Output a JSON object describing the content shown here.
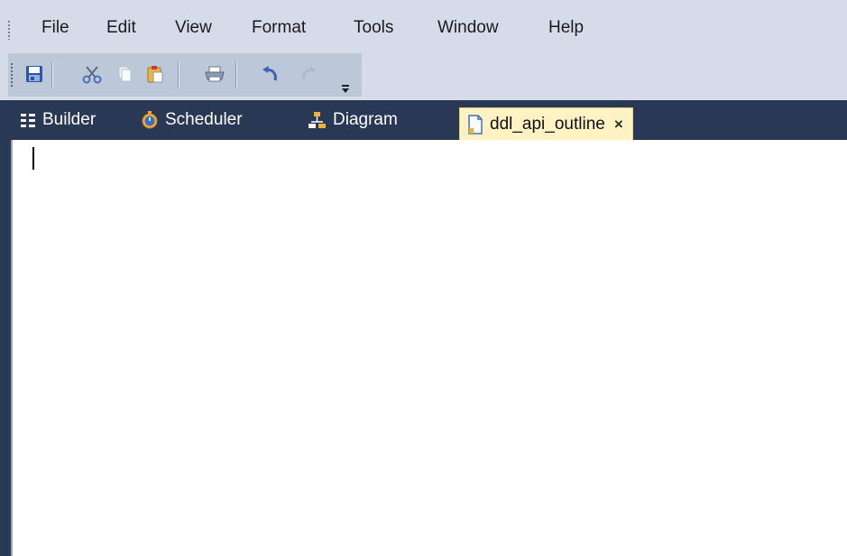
{
  "menu": {
    "items": [
      "File",
      "Edit",
      "View",
      "Format",
      "Tools",
      "Window",
      "Help"
    ]
  },
  "toolbar": {
    "buttons": [
      "save-icon",
      "cut-icon",
      "copy-icon",
      "paste-icon",
      "print-icon",
      "undo-icon",
      "redo-icon"
    ]
  },
  "tabs": {
    "builder": "Builder",
    "scheduler": "Scheduler",
    "diagram": "Diagram",
    "active": "ddl_api_outline",
    "close": "×"
  },
  "editor": {
    "content": ""
  },
  "colors": {
    "menubar": "#d6dbe9",
    "toolbar": "#bcc7d8",
    "tabstrip": "#293955",
    "active_tab": "#fff3c4",
    "editor_bg": "#ffffff"
  }
}
